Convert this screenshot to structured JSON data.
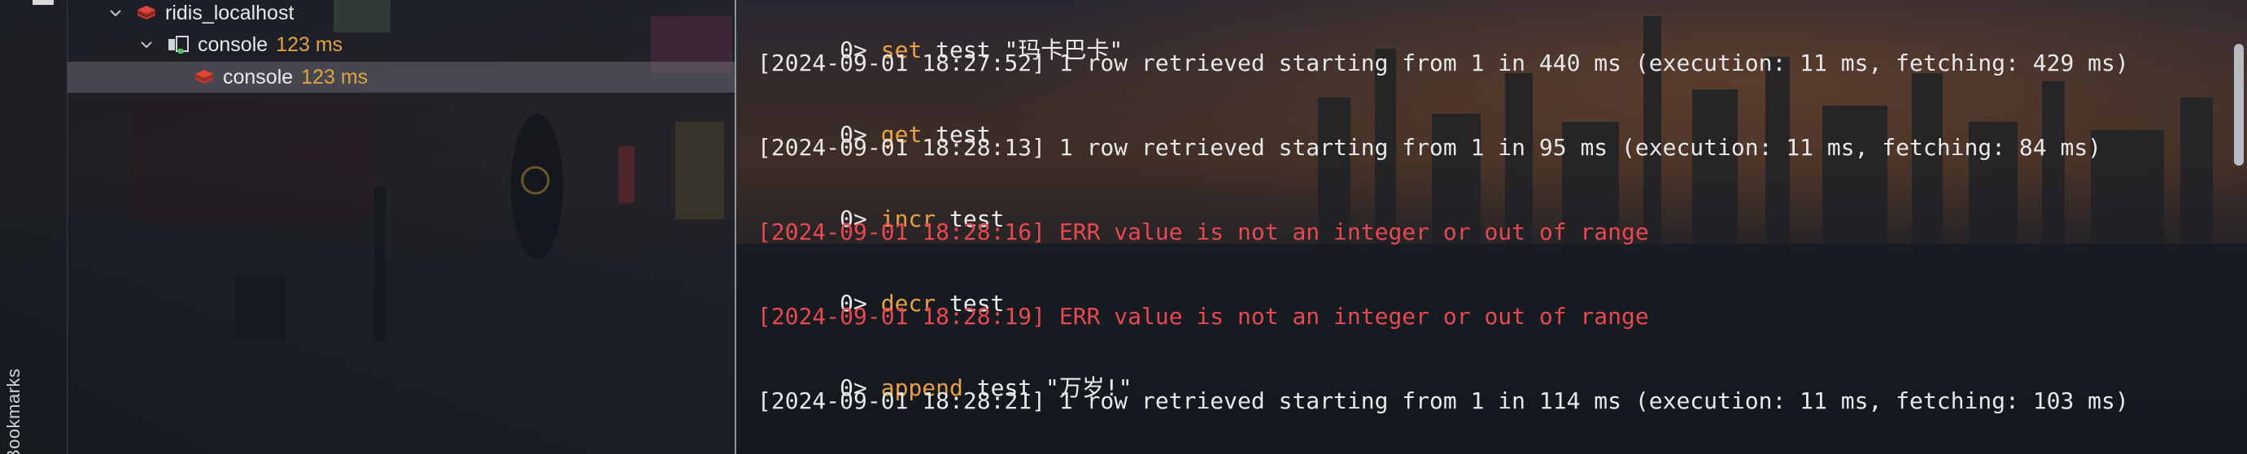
{
  "sidebar": {
    "bookmarks_label": "Bookmarks"
  },
  "tree": {
    "items": [
      {
        "label": "ridis_localhost",
        "timing": ""
      },
      {
        "label": "console",
        "timing": "123 ms"
      },
      {
        "label": "console",
        "timing": "123 ms"
      }
    ]
  },
  "console": {
    "lines": [
      {
        "prompt": "0> ",
        "command": "set",
        "args": " test \"玛卡巴卡\""
      },
      {
        "result": "[2024-09-01 18:27:52] 1 row retrieved starting from 1 in 440 ms (execution: 11 ms, fetching: 429 ms)"
      },
      {
        "prompt": "0> ",
        "command": "get",
        "args": " test"
      },
      {
        "result": "[2024-09-01 18:28:13] 1 row retrieved starting from 1 in 95 ms (execution: 11 ms, fetching: 84 ms)"
      },
      {
        "prompt": "0> ",
        "command": "incr",
        "args": " test"
      },
      {
        "error": "[2024-09-01 18:28:16] ERR value is not an integer or out of range"
      },
      {
        "prompt": "0> ",
        "command": "decr",
        "args": " test"
      },
      {
        "error": "[2024-09-01 18:28:19] ERR value is not an integer or out of range"
      },
      {
        "prompt": "0> ",
        "command": "append",
        "args": " test \"万岁!\""
      },
      {
        "result": "[2024-09-01 18:28:21] 1 row retrieved starting from 1 in 114 ms (execution: 11 ms, fetching: 103 ms)"
      }
    ]
  },
  "colors": {
    "keyword": "#e8a046",
    "error": "#e8484f",
    "timing": "#e0a340",
    "text": "#e8e8e8"
  }
}
